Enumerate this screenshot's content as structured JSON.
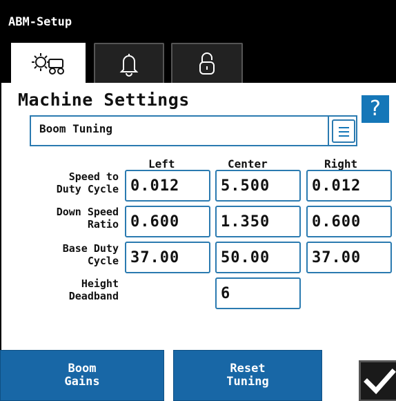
{
  "window": {
    "title": "ABM-Setup"
  },
  "tabs": [
    {
      "icon": "gear-machine-icon",
      "active": true
    },
    {
      "icon": "bell-icon",
      "active": false
    },
    {
      "icon": "lock-icon",
      "active": false
    }
  ],
  "section": {
    "title": "Machine Settings",
    "help_label": "?"
  },
  "dropdown": {
    "value": "Boom Tuning",
    "icon": "menu-icon"
  },
  "columns": [
    "Left",
    "Center",
    "Right"
  ],
  "rows": [
    {
      "label_line1": "Speed to",
      "label_line2": "Duty Cycle",
      "values": [
        "0.012",
        "5.500",
        "0.012"
      ]
    },
    {
      "label_line1": "Down Speed",
      "label_line2": "Ratio",
      "values": [
        "0.600",
        "1.350",
        "0.600"
      ]
    },
    {
      "label_line1": "Base Duty",
      "label_line2": "Cycle",
      "values": [
        "37.00",
        "50.00",
        "37.00"
      ]
    },
    {
      "label_line1": "Height",
      "label_line2": "Deadband",
      "values": [
        "6"
      ]
    }
  ],
  "buttons": {
    "boom_gains": {
      "line1": "Boom",
      "line2": "Gains"
    },
    "reset_tuning": {
      "line1": "Reset",
      "line2": "Tuning"
    },
    "confirm_icon": "checkmark-icon"
  },
  "colors": {
    "accent": "#1577b8",
    "button": "#1867a6",
    "titlebar": "#000000"
  }
}
